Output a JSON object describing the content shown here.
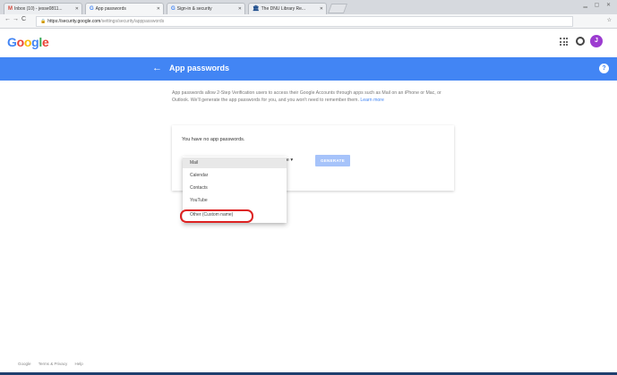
{
  "browser": {
    "tabs": [
      {
        "label": "Inbox (10) - jesse0811...",
        "favicon": "M"
      },
      {
        "label": "App passwords",
        "favicon": "G"
      },
      {
        "label": "Sign-in & security",
        "favicon": "G"
      },
      {
        "label": "The DNU Library Re...",
        "favicon": "🏛"
      }
    ],
    "url_host": "https://security.google.com",
    "url_path": "/settings/security/apppasswords",
    "nav_back": "←",
    "nav_forward": "→",
    "nav_reload": "C",
    "nav_home": "⌂"
  },
  "header": {
    "logo": [
      "G",
      "o",
      "o",
      "g",
      "l",
      "e"
    ],
    "avatar_initial": "J",
    "accent_color": "#4285f4"
  },
  "page": {
    "title": "App passwords",
    "description": "App passwords allow 2-Step Verification users to access their Google Accounts through apps such as Mail on an iPhone or Mac, or Outlook. We'll generate the app passwords for you, and you won't need to remember them.",
    "learn_more": "Learn more",
    "empty_message": "You have no app passwords.",
    "select_tail": "ce ▾",
    "generate_label": "GENERATE"
  },
  "dropdown": {
    "options": [
      "Mail",
      "Calendar",
      "Contacts",
      "YouTube",
      "Other (Custom name)"
    ],
    "selected": "Mail"
  },
  "footer": {
    "links": [
      "Google",
      "Terms & Privacy",
      "Help"
    ]
  },
  "icons": {
    "back": "arrow-back-icon",
    "help": "help-icon",
    "apps": "apps-grid-icon",
    "notifications": "notifications-icon"
  }
}
